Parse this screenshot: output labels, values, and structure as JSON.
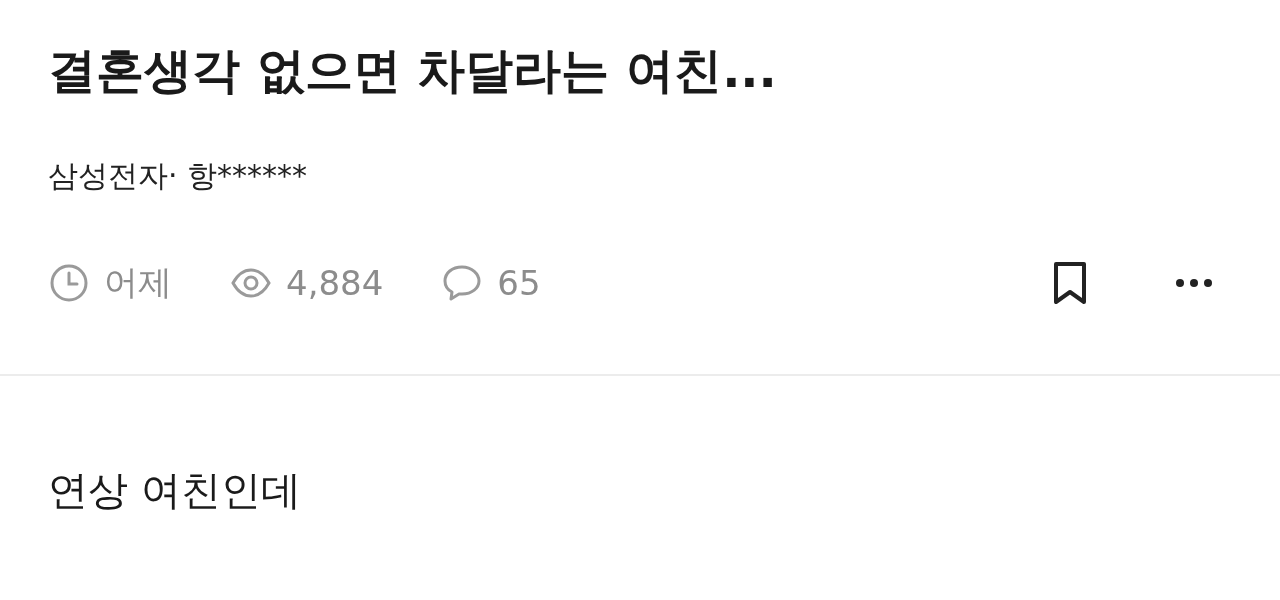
{
  "post": {
    "title": "결혼생각 없으면 차달라는 여친...",
    "author": "삼성전자· 항******",
    "meta": {
      "time": "어제",
      "views": "4,884",
      "comments": "65"
    },
    "bookmarked": false,
    "body": "연상 여친인데"
  }
}
